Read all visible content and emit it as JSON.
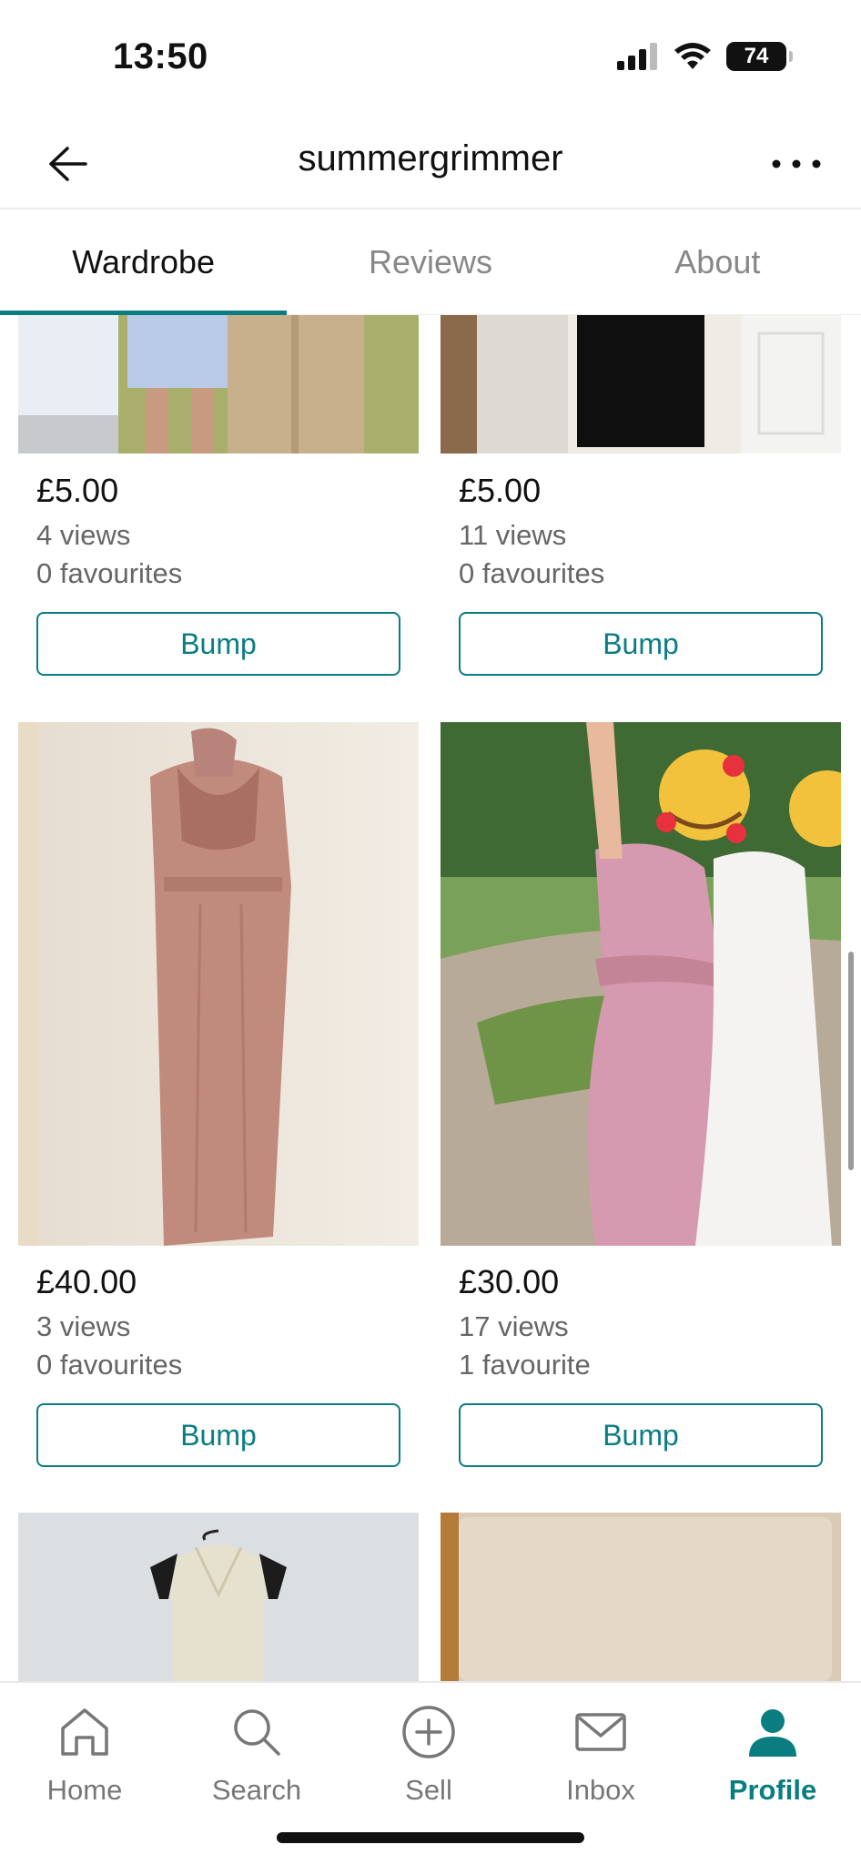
{
  "status_bar": {
    "time": "13:50",
    "battery": "74"
  },
  "header": {
    "title": "summergrimmer"
  },
  "tabs": [
    {
      "label": "Wardrobe",
      "active": true
    },
    {
      "label": "Reviews",
      "active": false
    },
    {
      "label": "About",
      "active": false
    }
  ],
  "items": [
    {
      "price": "£5.00",
      "views": "4 views",
      "favourites": "0 favourites",
      "bump_label": "Bump"
    },
    {
      "price": "£5.00",
      "views": "11 views",
      "favourites": "0 favourites",
      "bump_label": "Bump"
    },
    {
      "price": "£40.00",
      "views": "3 views",
      "favourites": "0 favourites",
      "bump_label": "Bump"
    },
    {
      "price": "£30.00",
      "views": "17 views",
      "favourites": "1 favourite",
      "bump_label": "Bump"
    }
  ],
  "bottom_nav": [
    {
      "label": "Home",
      "icon": "home-icon"
    },
    {
      "label": "Search",
      "icon": "search-icon"
    },
    {
      "label": "Sell",
      "icon": "plus-circle-icon"
    },
    {
      "label": "Inbox",
      "icon": "mail-icon"
    },
    {
      "label": "Profile",
      "icon": "person-icon",
      "active": true
    }
  ],
  "colors": {
    "accent": "#0a7d81"
  }
}
